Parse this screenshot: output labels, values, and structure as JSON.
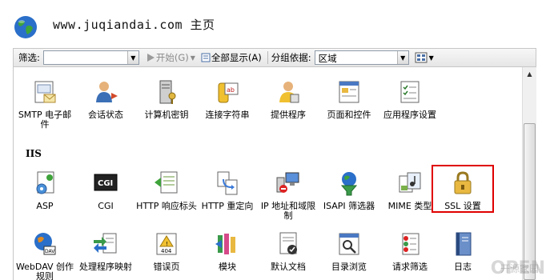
{
  "header": {
    "title": "www.juqiandai.com 主页"
  },
  "toolbar": {
    "filter_label": "筛选:",
    "filter_value": "",
    "start_label": "开始(G)",
    "show_all_label": "全部显示(A)",
    "group_label": "分组依据:",
    "group_value": "区域"
  },
  "section": {
    "iis_label": "IIS"
  },
  "icons": {
    "row1": [
      "SMTP 电子邮件",
      "会话状态",
      "计算机密钥",
      "连接字符串",
      "提供程序",
      "页面和控件",
      "应用程序设置"
    ],
    "row2": [
      "ASP",
      "CGI",
      "HTTP 响应标头",
      "HTTP 重定向",
      "IP 地址和域限制",
      "ISAPI 筛选器",
      "MIME 类型",
      "SSL 设置"
    ],
    "row3": [
      "WebDAV 创作规则",
      "处理程序映射",
      "错误页",
      "模块",
      "默认文档",
      "目录浏览",
      "请求筛选",
      "日志"
    ]
  },
  "watermark": {
    "main": "OPEN",
    "sub": "开源家园"
  },
  "colors": {
    "highlight": "#e00000",
    "accent": "#2a6fc9"
  }
}
